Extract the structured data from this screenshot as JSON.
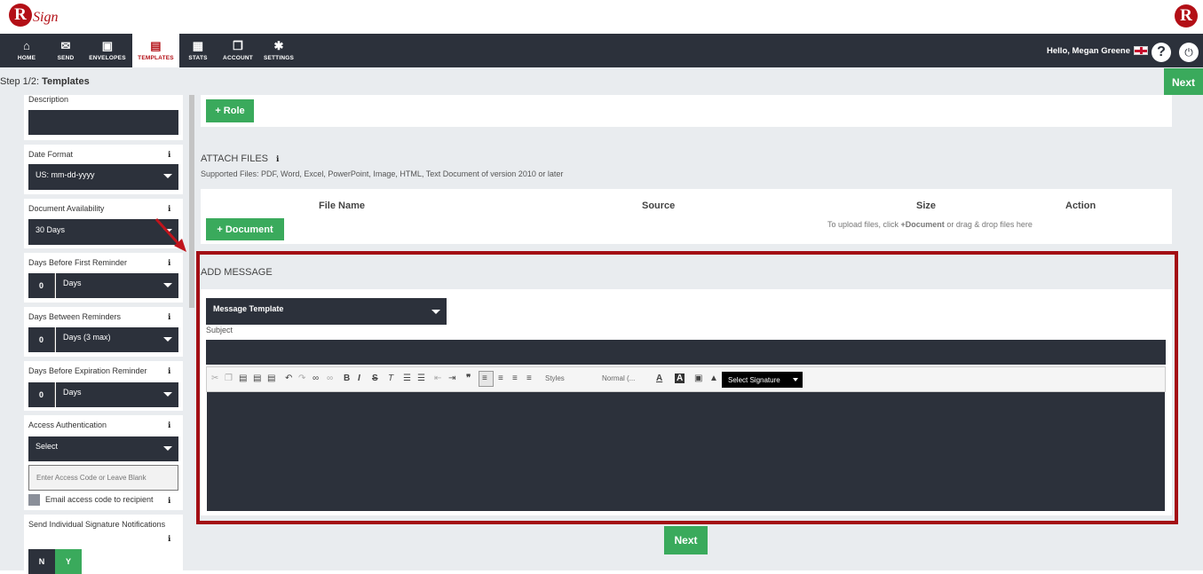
{
  "app": {
    "logo_text": "Sign",
    "logo_letter": "R"
  },
  "nav": {
    "items": [
      {
        "label": "HOME",
        "icon": "home-icon"
      },
      {
        "label": "SEND",
        "icon": "envelope-icon"
      },
      {
        "label": "ENVELOPES",
        "icon": "inbox-icon"
      },
      {
        "label": "TEMPLATES",
        "icon": "template-icon",
        "active": true
      },
      {
        "label": "STATS",
        "icon": "briefcase-icon"
      },
      {
        "label": "ACCOUNT",
        "icon": "copy-icon"
      },
      {
        "label": "SETTINGS",
        "icon": "gear-icon"
      }
    ],
    "greeting": "Hello, Megan Greene",
    "help_glyph": "?",
    "power_glyph": "⏻"
  },
  "step": {
    "prefix": "Step 1/2:",
    "name": "Templates",
    "next_label": "Next"
  },
  "sidebar": {
    "description_label": "Description",
    "date_format": {
      "label": "Date Format",
      "value": "US: mm-dd-yyyy"
    },
    "document_availability": {
      "label": "Document Availability",
      "value": "30 Days"
    },
    "first_reminder": {
      "label": "Days Before First Reminder",
      "number": "0",
      "unit": "Days"
    },
    "between_reminders": {
      "label": "Days Between Reminders",
      "number": "0",
      "unit": "Days (3 max)"
    },
    "expiration_reminder": {
      "label": "Days Before Expiration Reminder",
      "number": "0",
      "unit": "Days"
    },
    "access_auth": {
      "label": "Access Authentication",
      "value": "Select",
      "placeholder": "Enter Access Code or Leave Blank",
      "email_label": "Email access code to recipient"
    },
    "individual_notifications": {
      "label": "Send Individual Signature Notifications",
      "no": "N",
      "yes": "Y"
    }
  },
  "main": {
    "role_button": "+ Role",
    "attach": {
      "title": "ATTACH FILES",
      "supported": "Supported Files: PDF, Word, Excel, PowerPoint, Image, HTML, Text Document of version 2010 or later",
      "columns": [
        "File Name",
        "Source",
        "Size",
        "Action"
      ],
      "document_button": "+ Document",
      "hint_pre": "To upload files, click ",
      "hint_bold": "+Document",
      "hint_post": " or drag & drop files here"
    },
    "message": {
      "title": "ADD MESSAGE",
      "template_select": "Message Template",
      "subject_label": "Subject",
      "styles_label": "Styles",
      "format_label": "Normal (...",
      "signature_select": "Select Signature"
    },
    "next_label": "Next"
  },
  "colors": {
    "nav_bg": "#2c313b",
    "accent_red": "#b30f16",
    "green": "#3aaa5c",
    "panel_bg": "#e9ecef"
  }
}
